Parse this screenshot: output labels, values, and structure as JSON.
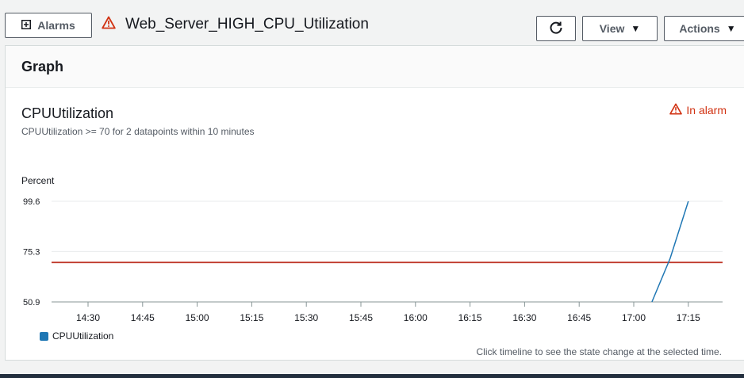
{
  "header": {
    "alarms_button": "Alarms",
    "title": "Web_Server_HIGH_CPU_Utilization",
    "view_button": "View",
    "actions_button": "Actions"
  },
  "panel": {
    "heading": "Graph",
    "metric_title": "CPUUtilization",
    "condition": "CPUUtilization >= 70 for 2 datapoints within 10 minutes",
    "state": "In alarm",
    "footnote": "Click timeline to see the state change at the selected time."
  },
  "colors": {
    "series": "#1f77b4",
    "threshold": "#c0392b",
    "alarm": "#d13212"
  },
  "chart_data": {
    "type": "line",
    "ylabel": "Percent",
    "yticks": [
      50.9,
      75.3,
      99.6
    ],
    "ylim": [
      50.9,
      99.6
    ],
    "xticks": [
      "14:30",
      "14:45",
      "15:00",
      "15:15",
      "15:30",
      "15:45",
      "16:00",
      "16:15",
      "16:30",
      "16:45",
      "17:00",
      "17:15"
    ],
    "grid": true,
    "legend_position": "bottom-left",
    "threshold": {
      "value": 70
    },
    "series": [
      {
        "name": "CPUUtilization",
        "points": [
          {
            "x": "17:05",
            "y": 50.9
          },
          {
            "x": "17:10",
            "y": 72.0
          },
          {
            "x": "17:15",
            "y": 99.6
          }
        ]
      }
    ]
  }
}
